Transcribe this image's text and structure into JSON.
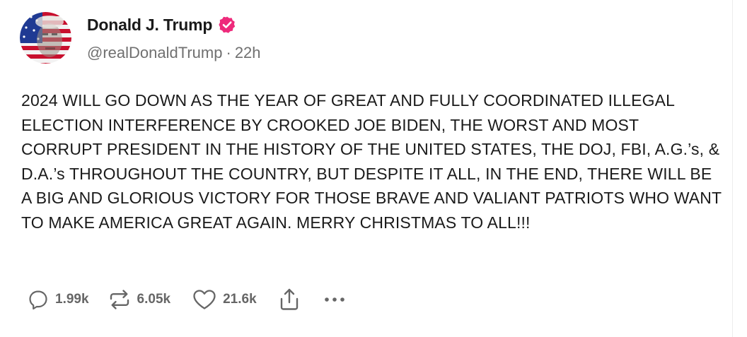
{
  "author": {
    "display_name": "Donald J. Trump",
    "handle": "@realDonaldTrump",
    "separator": "·",
    "time_ago": "22h",
    "verified": true
  },
  "post": {
    "text": "2024 WILL GO DOWN AS THE YEAR OF GREAT AND FULLY COORDINATED ILLEGAL ELECTION INTERFERENCE BY CROOKED JOE BIDEN, THE WORST AND MOST CORRUPT PRESIDENT IN THE HISTORY OF THE UNITED STATES, THE DOJ, FBI, A.G.’s, & D.A.’s THROUGHOUT THE COUNTRY, BUT DESPITE IT ALL, IN THE END, THERE WILL BE A BIG AND GLORIOUS VICTORY FOR THOSE BRAVE AND VALIANT PATRIOTS WHO WANT TO MAKE AMERICA GREAT AGAIN. MERRY CHRISTMAS TO ALL!!!"
  },
  "actions": {
    "replies": "1.99k",
    "reposts": "6.05k",
    "likes": "21.6k",
    "icons": [
      "reply-icon",
      "repost-icon",
      "heart-icon",
      "share-icon",
      "more-icon"
    ]
  },
  "colors": {
    "verified_badge": "#ee2a7b",
    "text": "#1a1a1a",
    "muted": "#707070",
    "action_icon": "#666666"
  }
}
